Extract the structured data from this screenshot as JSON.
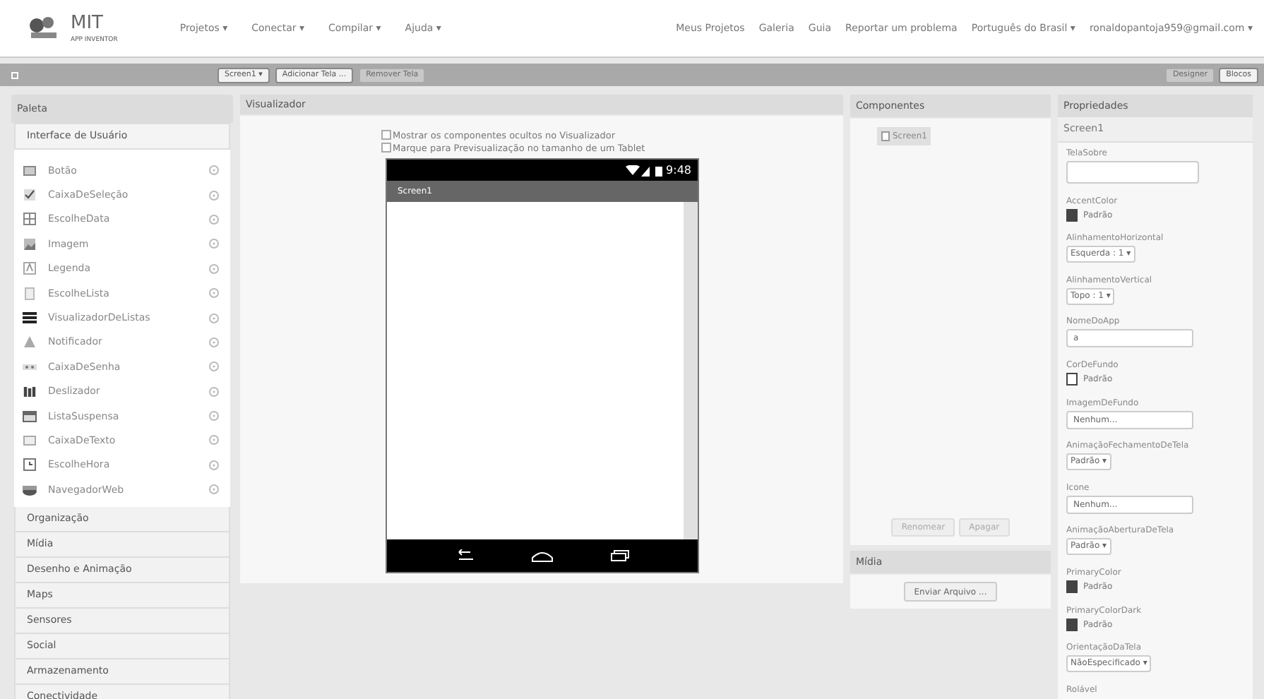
{
  "header": {
    "logo": {
      "title": "MIT",
      "subtitle": "APP INVENTOR"
    },
    "menus": [
      "Projetos ▾",
      "Conectar ▾",
      "Compilar ▾",
      "Ajuda ▾"
    ],
    "links": [
      "Meus Projetos",
      "Galeria",
      "Guia",
      "Reportar um problema",
      "Português do Brasil ▾",
      "ronaldopantoja959@gmail.com ▾"
    ]
  },
  "toolbar": {
    "left": [
      {
        "label": "Screen1 ▾",
        "disabled": false
      },
      {
        "label": "Adicionar Tela ...",
        "disabled": false
      },
      {
        "label": "Remover Tela",
        "disabled": true
      }
    ],
    "modes": [
      {
        "label": "Designer",
        "selected": true
      },
      {
        "label": "Blocos",
        "selected": false
      }
    ]
  },
  "palette": {
    "title": "Paleta",
    "open_category": "Interface de Usuário",
    "items": [
      {
        "label": "Botão",
        "kind": "button"
      },
      {
        "label": "CaixaDeSeleção",
        "kind": "checkbox"
      },
      {
        "label": "EscolheData",
        "kind": "calendar"
      },
      {
        "label": "Imagem",
        "kind": "image"
      },
      {
        "label": "Legenda",
        "kind": "label"
      },
      {
        "label": "EscolheLista",
        "kind": "list"
      },
      {
        "label": "VisualizadorDeListas",
        "kind": "listview"
      },
      {
        "label": "Notificador",
        "kind": "warning"
      },
      {
        "label": "CaixaDeSenha",
        "kind": "password"
      },
      {
        "label": "Deslizador",
        "kind": "slider"
      },
      {
        "label": "ListaSuspensa",
        "kind": "dropdown"
      },
      {
        "label": "CaixaDeTexto",
        "kind": "textbox"
      },
      {
        "label": "EscolheHora",
        "kind": "clock"
      },
      {
        "label": "NavegadorWeb",
        "kind": "browser"
      }
    ],
    "categories": [
      "Organização",
      "Mídia",
      "Desenho e Animação",
      "Maps",
      "Sensores",
      "Social",
      "Armazenamento",
      "Conectividade"
    ]
  },
  "viewer": {
    "title": "Visualizador",
    "options": [
      {
        "label": "Mostrar os componentes ocultos no Visualizador",
        "checked": false
      },
      {
        "label": "Marque para Previsualização no tamanho de um Tablet",
        "checked": false
      }
    ],
    "phone": {
      "time": "9:48",
      "screen_title": "Screen1"
    }
  },
  "components": {
    "title": "Componentes",
    "tree": [
      {
        "label": "Screen1",
        "selected": true
      }
    ],
    "buttons": [
      {
        "label": "Renomear",
        "disabled": true
      },
      {
        "label": "Apagar",
        "disabled": true
      }
    ]
  },
  "media": {
    "title": "Mídia",
    "button": "Enviar Arquivo ..."
  },
  "properties": {
    "title": "Propriedades",
    "component": "Screen1",
    "items": [
      {
        "label": "TelaSobre",
        "kind": "textarea"
      },
      {
        "label": "AccentColor",
        "kind": "color",
        "value": "Padrão",
        "color": "#444444"
      },
      {
        "label": "AlinhamentoHorizontal",
        "kind": "dropdown",
        "value": "Esquerda : 1 ▾"
      },
      {
        "label": "AlinhamentoVertical",
        "kind": "dropdown",
        "value": "Topo : 1 ▾"
      },
      {
        "label": "NomeDoApp",
        "kind": "text",
        "value": "a"
      },
      {
        "label": "CorDeFundo",
        "kind": "color",
        "value": "Padrão",
        "color": "#ffffff"
      },
      {
        "label": "ImagemDeFundo",
        "kind": "text",
        "value": "Nenhum..."
      },
      {
        "label": "AnimaçãoFechamentoDeTela",
        "kind": "dropdown",
        "value": "Padrão ▾"
      },
      {
        "label": "Icone",
        "kind": "text",
        "value": "Nenhum..."
      },
      {
        "label": "AnimaçãoAberturaDeTela",
        "kind": "dropdown",
        "value": "Padrão ▾"
      },
      {
        "label": "PrimaryColor",
        "kind": "color",
        "value": "Padrão",
        "color": "#444444"
      },
      {
        "label": "PrimaryColorDark",
        "kind": "color",
        "value": "Padrão",
        "color": "#444444"
      },
      {
        "label": "OrientaçãoDaTela",
        "kind": "dropdown",
        "value": "NãoEspecificado ▾"
      },
      {
        "label": "Rolável",
        "kind": "label"
      }
    ]
  }
}
